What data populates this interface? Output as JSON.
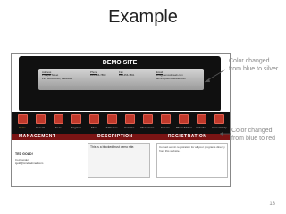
{
  "slide": {
    "title": "Example",
    "page_number": "13",
    "callouts": [
      "Color changed from blue to silver",
      "Color changed from blue to red"
    ]
  },
  "site": {
    "title": "DEMO SITE",
    "info": {
      "address_label": "Address",
      "address_lines": [
        "1 Maple Street",
        "ZIP: Mendotown, Fakestate"
      ],
      "phone_label": "Phone",
      "phone_lines": [
        "123-456-7890",
        ""
      ],
      "fax_label": "Fax",
      "fax_lines": [
        "123-456-7891",
        ""
      ],
      "email_label": "Email",
      "email_lines": [
        "info@demositeweb.com",
        "admin@demositeweb.com"
      ]
    },
    "nav": [
      {
        "label": "Home",
        "active": true
      },
      {
        "label": "General"
      },
      {
        "label": "Areas"
      },
      {
        "label": "Programs"
      },
      {
        "label": "Files"
      },
      {
        "label": "Addresses"
      },
      {
        "label": "Facilities"
      },
      {
        "label": "Discussions"
      },
      {
        "label": "Forums"
      },
      {
        "label": "Photos/Videos"
      },
      {
        "label": "Calendar"
      },
      {
        "label": "Account/Help"
      }
    ],
    "sections": {
      "management": "MANAGEMENT",
      "description": "DESCRIPTION",
      "registration": "REGISTRATION"
    },
    "description_text": "This is a blockedbrust demo site.",
    "registration_text": "Contact admin registration for all your programs directly from this website.",
    "user": {
      "name": "TED GOLD!",
      "role": "Co-Founder",
      "email": "tgold@mindwebmail.com"
    }
  }
}
